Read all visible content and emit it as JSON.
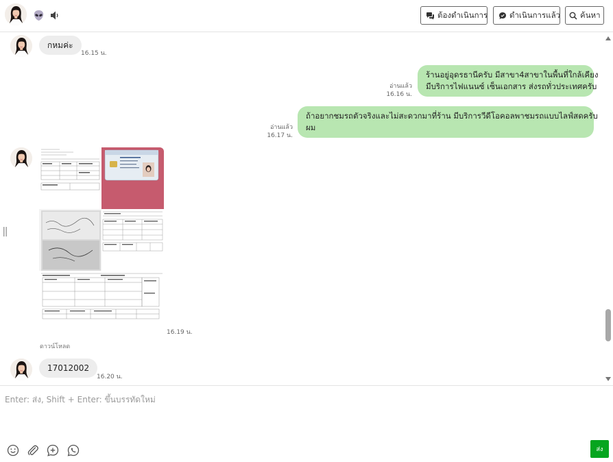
{
  "header": {
    "contact_avatar": "contact-photo-avatar",
    "alien_icon": "alien-emoji-icon",
    "speaker_icon": "speaker-icon",
    "btn_todo": "ต้องดำเนินการ",
    "btn_done": "ดำเนินการแล้ว",
    "btn_search": "ค้นหา"
  },
  "messages": [
    {
      "side": "in",
      "text": "กหมค่ะ",
      "time": "16.15 น."
    },
    {
      "side": "out",
      "read": "อ่านแล้ว",
      "time": "16.16 น.",
      "lines": [
        "ร้านอยู่อุดรธานีครับ มีสาขา4สาขาในพื้นที่ใกล้เคียง",
        "มีบริการไฟแนนซ์ เซ็นเอกสาร ส่งรถทั่วประเทศครับ"
      ]
    },
    {
      "side": "out",
      "read": "อ่านแล้ว",
      "time": "16.17 น.",
      "lines": [
        "ถ้าอยากชมรถตัวจริงและไม่สะดวกมาที่ร้าน มีบริการวีดีโอคอลพาชมรถแบบไลฟ์สดครับ",
        "ผม"
      ]
    },
    {
      "side": "in",
      "type": "image",
      "time": "16.19 น.",
      "download": "ดาวน์โหลด"
    },
    {
      "side": "in",
      "text": "17012002",
      "time": "16.20 น."
    }
  ],
  "composer": {
    "placeholder": "Enter: ส่ง, Shift + Enter: ขึ้นบรรทัดใหม่",
    "send_label": "ส่ง",
    "tools": [
      "emoji-icon",
      "attachment-icon",
      "add-circle-icon",
      "whatsapp-icon"
    ]
  },
  "colors": {
    "out_bubble": "#b8e6b1",
    "in_bubble": "#ededed",
    "send": "#06a51f"
  }
}
